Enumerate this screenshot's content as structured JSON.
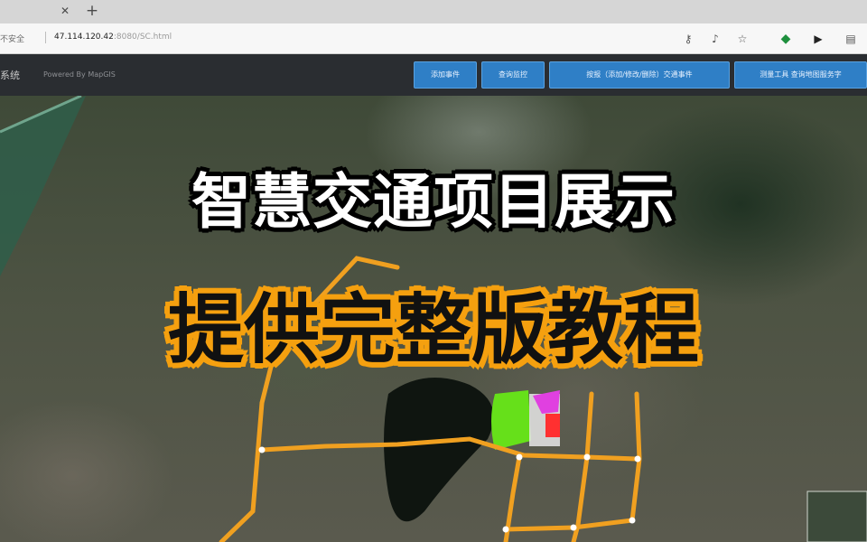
{
  "browser": {
    "tab_close_icon": "close-icon",
    "tab_new_icon": "plus-icon",
    "security_label": "不安全",
    "url_host": "47.114.120.42",
    "url_rest": ":8080/SC.html",
    "toolbar_icons": [
      "key-icon",
      "read-aloud-icon",
      "favorites-icon",
      "shield-icon",
      "play-icon",
      "collections-icon"
    ]
  },
  "app": {
    "title": "系统",
    "powered_by": "Powered By MapGIS",
    "nav_buttons": [
      "添加事件",
      "查询监控",
      "按报（添加/修改/删除）交通事件",
      "测量工具 查询地图服务字"
    ]
  },
  "overlay": {
    "headline": "智慧交通项目展示",
    "subheadline": "提供完整版教程",
    "headline_color": "#ffffff",
    "subheadline_color": "#111111",
    "accent_color": "#f5a00f"
  },
  "map": {
    "road_color": "#f0a020",
    "buffer_colors": [
      "#66e01a",
      "#e040e0",
      "#ff3030"
    ]
  }
}
